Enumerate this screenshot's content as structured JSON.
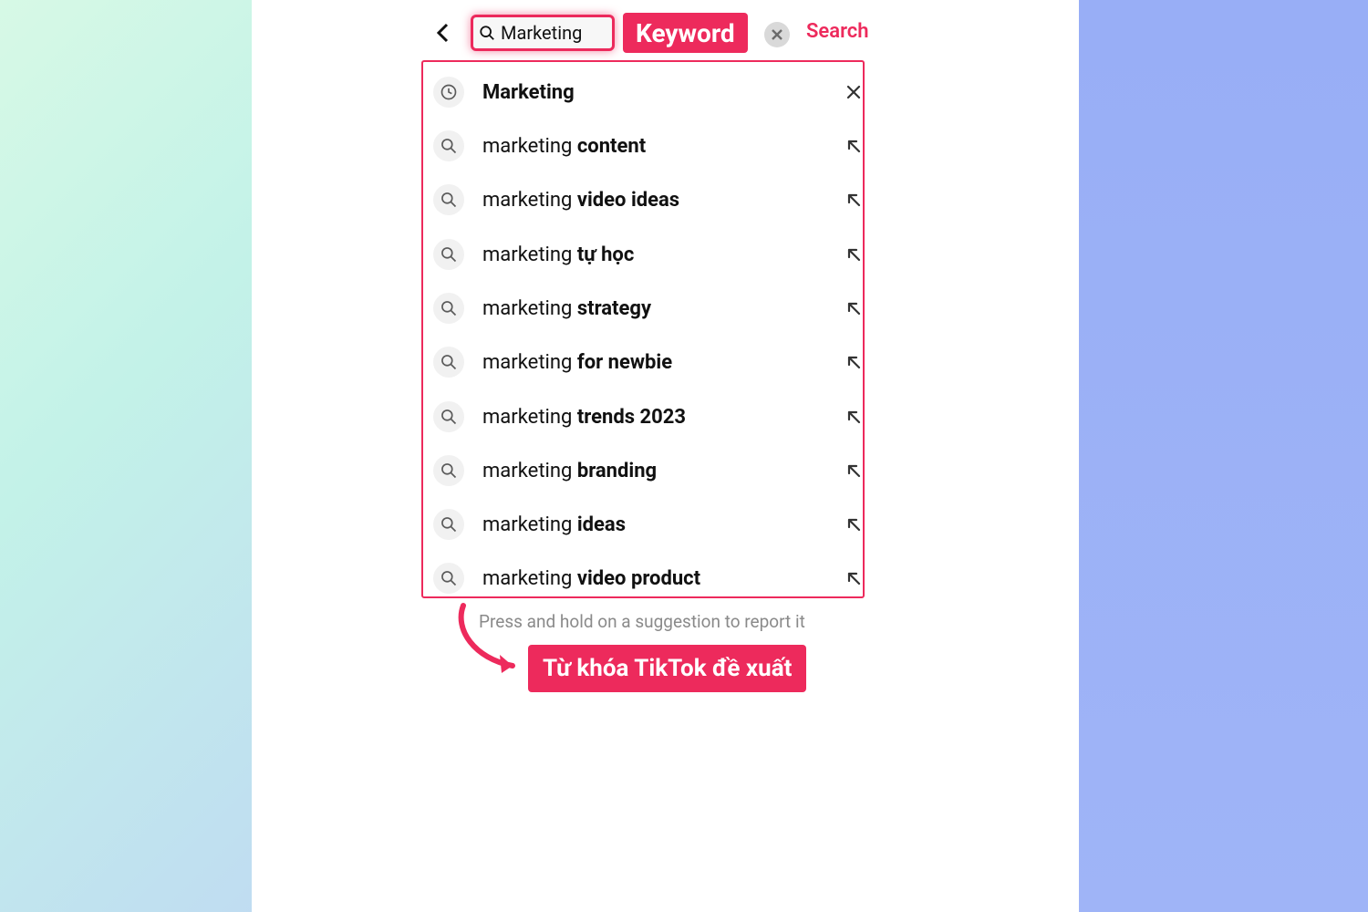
{
  "colors": {
    "accent": "#ed2a5c"
  },
  "header": {
    "search_value": "Marketing",
    "keyword_badge": "Keyword",
    "search_button": "Search"
  },
  "suggestions": [
    {
      "icon": "clock",
      "prefix": "",
      "bold": "Marketing",
      "action": "close"
    },
    {
      "icon": "search",
      "prefix": "marketing ",
      "bold": "content",
      "action": "insert"
    },
    {
      "icon": "search",
      "prefix": "marketing ",
      "bold": "video ideas",
      "action": "insert"
    },
    {
      "icon": "search",
      "prefix": "marketing ",
      "bold": "tự học",
      "action": "insert"
    },
    {
      "icon": "search",
      "prefix": "marketing ",
      "bold": "strategy",
      "action": "insert"
    },
    {
      "icon": "search",
      "prefix": "marketing ",
      "bold": "for newbie",
      "action": "insert"
    },
    {
      "icon": "search",
      "prefix": "marketing ",
      "bold": "trends 2023",
      "action": "insert"
    },
    {
      "icon": "search",
      "prefix": "marketing ",
      "bold": "branding",
      "action": "insert"
    },
    {
      "icon": "search",
      "prefix": "marketing ",
      "bold": "ideas",
      "action": "insert"
    },
    {
      "icon": "search",
      "prefix": "marketing ",
      "bold": "video product",
      "action": "insert"
    }
  ],
  "hint": "Press and hold on a suggestion to report it",
  "callout": "Từ khóa TikTok đề xuất"
}
